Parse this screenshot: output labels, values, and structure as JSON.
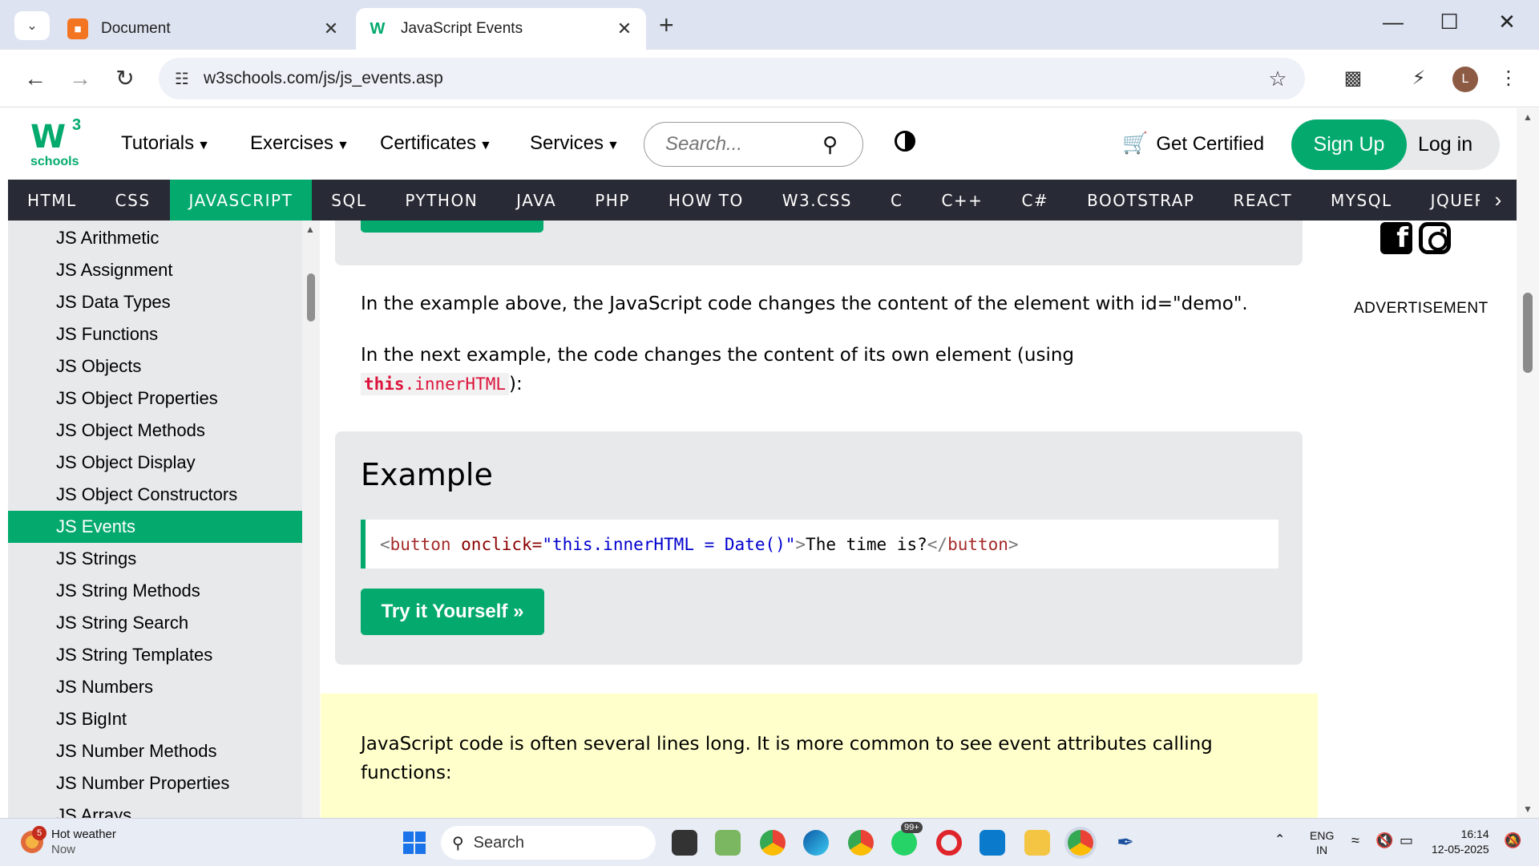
{
  "browser": {
    "tabs": [
      {
        "title": "Document",
        "active": false
      },
      {
        "title": "JavaScript Events",
        "active": true
      }
    ],
    "url": "w3schools.com/js/js_events.asp",
    "profile_initial": "L"
  },
  "header": {
    "logo_sup": "3",
    "logo_text": "schools",
    "menu": [
      "Tutorials",
      "Exercises",
      "Certificates",
      "Services"
    ],
    "search_placeholder": "Search...",
    "get_certified": "Get Certified",
    "sign_up": "Sign Up",
    "log_in": "Log in"
  },
  "topnav": {
    "items": [
      "HTML",
      "CSS",
      "JAVASCRIPT",
      "SQL",
      "PYTHON",
      "JAVA",
      "PHP",
      "HOW TO",
      "W3.CSS",
      "C",
      "C++",
      "C#",
      "BOOTSTRAP",
      "REACT",
      "MYSQL",
      "JQUER"
    ],
    "active": "JAVASCRIPT"
  },
  "sidebar": {
    "items": [
      {
        "label": "JS Arithmetic"
      },
      {
        "label": "JS Assignment"
      },
      {
        "label": "JS Data Types"
      },
      {
        "label": "JS Functions"
      },
      {
        "label": "JS Objects"
      },
      {
        "label": "JS Object Properties"
      },
      {
        "label": "JS Object Methods"
      },
      {
        "label": "JS Object Display"
      },
      {
        "label": "JS Object Constructors"
      },
      {
        "label": "JS Events",
        "active": true
      },
      {
        "label": "JS Strings"
      },
      {
        "label": "JS String Methods"
      },
      {
        "label": "JS String Search"
      },
      {
        "label": "JS String Templates"
      },
      {
        "label": "JS Numbers"
      },
      {
        "label": "JS BigInt"
      },
      {
        "label": "JS Number Methods"
      },
      {
        "label": "JS Number Properties"
      },
      {
        "label": "JS Arrays"
      }
    ]
  },
  "main": {
    "para1": "In the example above, the JavaScript code changes the content of the element with id=\"demo\".",
    "para2_line1": "In the next example, the code changes the content of its own element (using",
    "para2_code_kw": "this",
    "para2_code_rest": ".innerHTML",
    "para2_end": "):",
    "example_title": "Example",
    "code": {
      "lt1": "<",
      "tag1": "button",
      "attr": " onclick=",
      "val": "\"this.innerHTML = Date()\"",
      "gt1": ">",
      "text": "The time is?",
      "lt2": "</",
      "tag2": "button",
      "gt2": ">"
    },
    "try_button": "Try it Yourself »",
    "note": "JavaScript code is often several lines long. It is more common to see event attributes calling functions:"
  },
  "rightcol": {
    "advertisement": "ADVERTISEMENT",
    "facebook_glyph": "f"
  },
  "taskbar": {
    "weather_badge": "5",
    "weather_title": "Hot weather",
    "weather_sub": "Now",
    "search": "Search",
    "whatsapp_badge": "99+",
    "lang_top": "ENG",
    "lang_bottom": "IN",
    "time": "16:14",
    "date": "12-05-2025"
  }
}
